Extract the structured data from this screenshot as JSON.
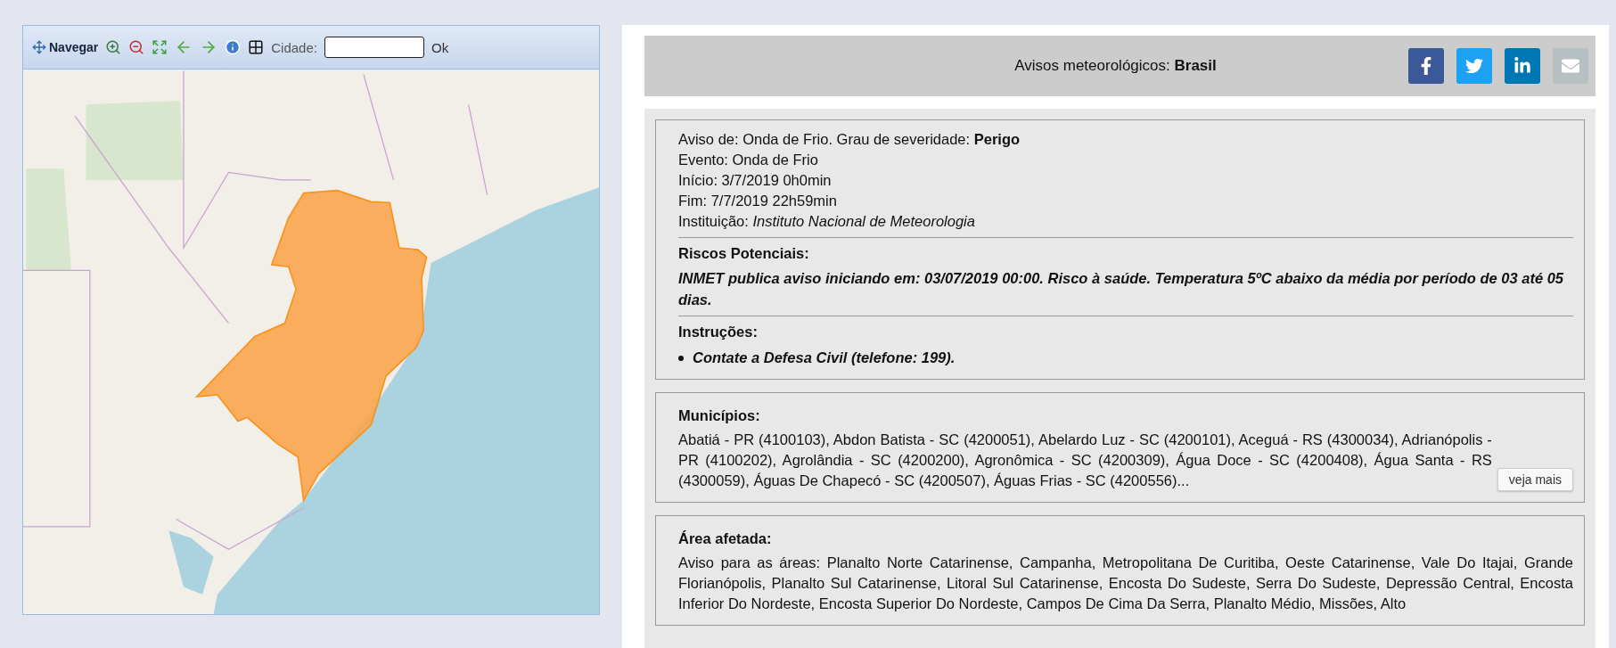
{
  "map_panel": {
    "toolbar": {
      "nav_label": "Navegar",
      "tools": [
        {
          "kind": "zoom-in"
        },
        {
          "kind": "zoom-out"
        },
        {
          "kind": "full-extent"
        },
        {
          "kind": "back"
        },
        {
          "kind": "forward"
        },
        {
          "kind": "info"
        },
        {
          "kind": "grid"
        }
      ],
      "city_label": "Cidade:",
      "ok_label": "Ok"
    }
  },
  "header": {
    "title": "Avisos meteorológicos: **Brasil**",
    "share": [
      {
        "kind": "facebook"
      },
      {
        "kind": "twitter"
      },
      {
        "kind": "linkedin"
      },
      {
        "kind": "email"
      }
    ]
  },
  "alert": {
    "lines": [
      "Aviso de: Onda de Frio. Grau de severidade: **Perigo**",
      "Evento: Onda de Frio",
      "Início: 3/7/2019 0h0min",
      "Fim: 7/7/2019 22h59min",
      "Instituição: *Instituto Nacional de Meteorologia*"
    ],
    "risks": {
      "heading": "Riscos Potenciais:",
      "text": "INMET publica aviso iniciando em: 03/07/2019 00:00. Risco à saúde. Temperatura 5ºC abaixo da média por período de 03 até 05 dias."
    },
    "instructions": {
      "heading": "Instruções:",
      "items": [
        "Contate a Defesa Civil (telefone: 199)."
      ]
    }
  },
  "municipios": {
    "heading": "Municípios:",
    "text": "Abatiá - PR (4100103), Abdon Batista - SC (4200051), Abelardo Luz - SC (4200101), Aceguá - RS (4300034), Adrianópolis - PR (4100202), Agrolândia - SC (4200200), Agronômica - SC (4200309), Água Doce - SC (4200408), Água Santa - RS (4300059), Águas De Chapecó - SC (4200507), Águas Frias - SC (4200556)...",
    "more_button": "veja mais"
  },
  "area": {
    "heading": "Área afetada:",
    "text": "Aviso para as áreas: Planalto Norte Catarinense, Campanha, Metropolitana De Curitiba, Oeste Catarinense, Vale Do Itajai, Grande Florianópolis, Planalto Sul Catarinense, Litoral Sul Catarinense, Encosta Do Sudeste, Serra Do Sudeste, Depressão Central, Encosta Inferior Do Nordeste, Encosta Superior Do Nordeste, Campos De Cima Da Serra, Planalto Médio, Missões, Alto"
  }
}
